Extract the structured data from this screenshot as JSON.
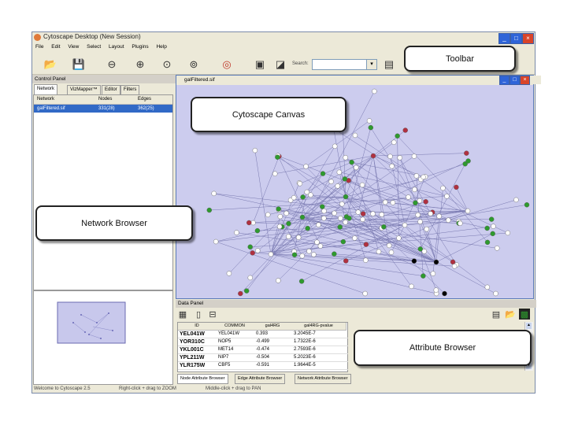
{
  "window": {
    "title": "Cytoscape Desktop (New Session)",
    "buttons": [
      "_",
      "□",
      "×"
    ]
  },
  "menu": [
    "File",
    "Edit",
    "View",
    "Select",
    "Layout",
    "Plugins",
    "Help"
  ],
  "toolbar": {
    "icons": [
      "open-icon",
      "save-icon",
      "zoom-out-icon",
      "zoom-in-icon",
      "zoom-fit-icon",
      "zoom-selected-icon",
      "layout-icon",
      "first-neighbors-icon",
      "hide-icon",
      "details-icon"
    ],
    "search_label": "Search:",
    "search_value": ""
  },
  "control_panel": {
    "title": "Control Panel",
    "tabs": [
      "Network",
      "VizMapper™",
      "Editor",
      "Filters"
    ],
    "columns": [
      "Network",
      "Nodes",
      "Edges"
    ],
    "rows": [
      {
        "network": "galFiltered.sif",
        "nodes": "331(28)",
        "edges": "362(25)"
      }
    ]
  },
  "canvas": {
    "title": "galFiltered.sif",
    "background": "#ccccee"
  },
  "data_panel": {
    "title": "Data Panel",
    "columns": [
      "ID",
      "COMMON",
      "gal4RG",
      "gal4RG-pvalue"
    ],
    "rows": [
      {
        "id": "YEL041W",
        "common": "YEL041W",
        "val": "0.393",
        "pval": "3.2045E-7"
      },
      {
        "id": "YOR310C",
        "common": "NOP5",
        "val": "-0.499",
        "pval": "1.7322E-6"
      },
      {
        "id": "YKL001C",
        "common": "MET14",
        "val": "-0.474",
        "pval": "2.7593E-6"
      },
      {
        "id": "YPL211W",
        "common": "NIP7",
        "val": "-0.504",
        "pval": "5.2023E-6"
      },
      {
        "id": "YLR175W",
        "common": "CBF5",
        "val": "-0.591",
        "pval": "1.9644E-5"
      }
    ],
    "tabs": [
      "Node Attribute Browser",
      "Edge Attribute Browser",
      "Network Attribute Browser"
    ]
  },
  "status": {
    "left": "Welcome to Cytoscape 2.5",
    "middle": "Right-click + drag to  ZOOM",
    "right": "Middle-click + drag to  PAN"
  },
  "callouts": {
    "toolbar": "Toolbar",
    "canvas": "Cytoscape Canvas",
    "network_browser": "Network Browser",
    "attribute_browser": "Attribute Browser"
  },
  "colors": {
    "node_green": "#2e9a2e",
    "node_red": "#b03040",
    "node_white": "#ffffff",
    "node_black": "#000000",
    "selection": "#3169c6"
  }
}
